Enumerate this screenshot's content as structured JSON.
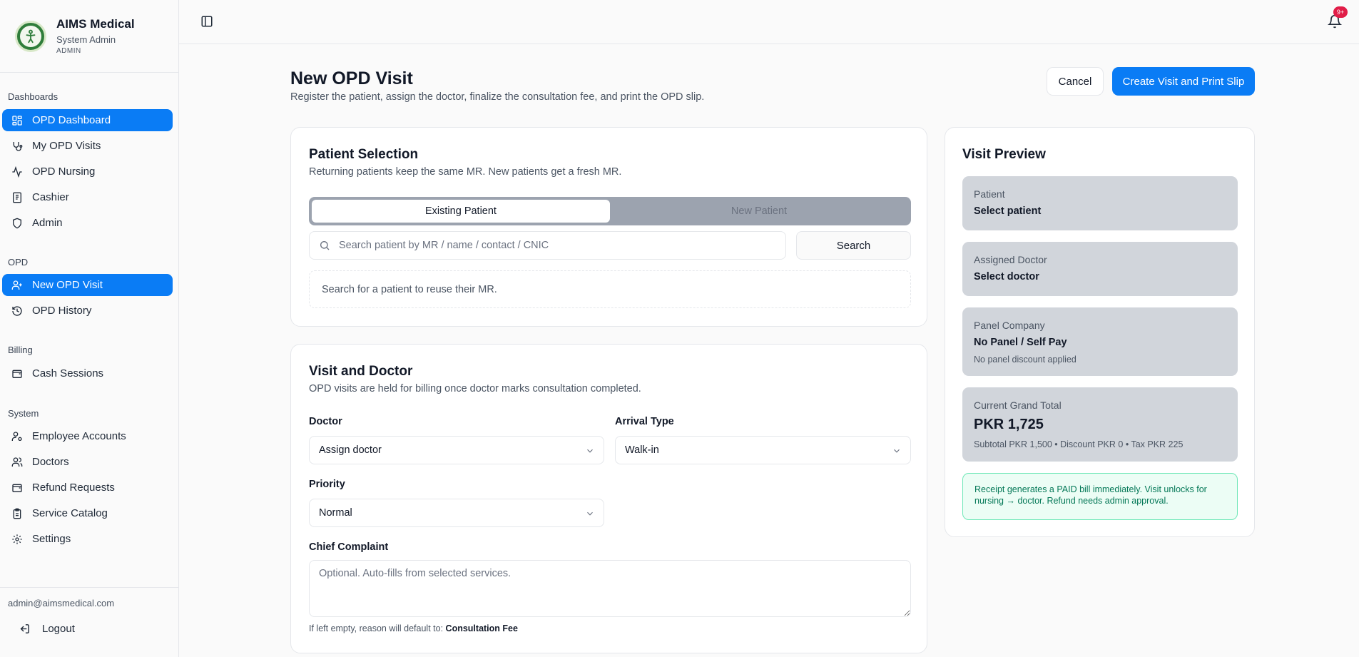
{
  "brand": {
    "name": "AIMS Medical",
    "role": "System Admin",
    "badge": "ADMIN"
  },
  "sidebar": {
    "groups": [
      {
        "label": "Dashboards",
        "items": [
          {
            "label": "OPD Dashboard",
            "icon": "dashboard-icon",
            "active": true
          },
          {
            "label": "My OPD Visits",
            "icon": "stethoscope-icon"
          },
          {
            "label": "OPD Nursing",
            "icon": "activity-icon"
          },
          {
            "label": "Cashier",
            "icon": "receipt-icon"
          },
          {
            "label": "Admin",
            "icon": "shield-icon"
          }
        ]
      },
      {
        "label": "OPD",
        "items": [
          {
            "label": "New OPD Visit",
            "icon": "user-plus-icon",
            "active": true
          },
          {
            "label": "OPD History",
            "icon": "history-icon"
          }
        ]
      },
      {
        "label": "Billing",
        "items": [
          {
            "label": "Cash Sessions",
            "icon": "wallet-icon"
          }
        ]
      },
      {
        "label": "System",
        "items": [
          {
            "label": "Employee Accounts",
            "icon": "user-cog-icon"
          },
          {
            "label": "Doctors",
            "icon": "users-icon"
          },
          {
            "label": "Refund Requests",
            "icon": "wallet-icon"
          },
          {
            "label": "Service Catalog",
            "icon": "clipboard-icon"
          },
          {
            "label": "Settings",
            "icon": "gear-icon"
          }
        ]
      }
    ],
    "account_email": "admin@aimsmedical.com",
    "logout_label": "Logout"
  },
  "topbar": {
    "notification_count": "9+"
  },
  "header": {
    "title": "New OPD Visit",
    "subtitle": "Register the patient, assign the doctor, finalize the consultation fee, and print the OPD slip.",
    "cancel_label": "Cancel",
    "primary_label": "Create Visit and Print Slip"
  },
  "patient_selection": {
    "title": "Patient Selection",
    "description": "Returning patients keep the same MR. New patients get a fresh MR.",
    "tabs": [
      "Existing Patient",
      "New Patient"
    ],
    "active_tab": "Existing Patient",
    "search_placeholder": "Search patient by MR / name / contact / CNIC",
    "search_button": "Search",
    "empty_hint": "Search for a patient to reuse their MR."
  },
  "visit_doctor": {
    "title": "Visit and Doctor",
    "description": "OPD visits are held for billing once doctor marks consultation completed.",
    "doctor_label": "Doctor",
    "doctor_value": "Assign doctor",
    "arrival_label": "Arrival Type",
    "arrival_value": "Walk-in",
    "priority_label": "Priority",
    "priority_value": "Normal",
    "complaint_label": "Chief Complaint",
    "complaint_placeholder": "Optional. Auto-fills from selected services.",
    "help_prefix": "If left empty, reason will default to:",
    "help_default": "Consultation Fee"
  },
  "preview": {
    "title": "Visit Preview",
    "patient_label": "Patient",
    "patient_value": "Select patient",
    "doctor_label": "Assigned Doctor",
    "doctor_value": "Select doctor",
    "panel_label": "Panel Company",
    "panel_value": "No Panel / Self Pay",
    "panel_note": "No panel discount applied",
    "total_label": "Current Grand Total",
    "total_value": "PKR 1,725",
    "total_breakdown": "Subtotal PKR 1,500 • Discount PKR 0 • Tax PKR 225",
    "notice": "Receipt generates a PAID bill immediately. Visit unlocks for nursing → doctor. Refund needs admin approval."
  },
  "colors": {
    "accent": "#0a7cf5",
    "success_bg": "#ecfdf5",
    "success_text": "#047857",
    "badge": "#e11d48"
  }
}
